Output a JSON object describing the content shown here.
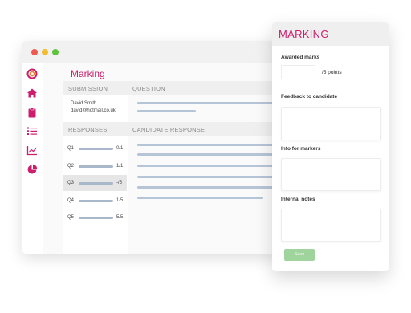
{
  "app": {
    "page_title": "Marking",
    "brand_color": "#cc1e6c"
  },
  "sidebar": {
    "icons": [
      "logo-icon",
      "home-icon",
      "clipboard-icon",
      "list-icon",
      "trend-icon",
      "pie-chart-icon",
      "user-icon"
    ]
  },
  "table": {
    "submission_header": "SUBMISSION",
    "question_header": "QUESTION",
    "responses_header": "RESPONSES",
    "candidate_response_header": "CANDIDATE RESPONSE",
    "candidate": {
      "name": "David Smith",
      "email": "david@hotmail.co.uk"
    },
    "responses": [
      {
        "label": "Q1",
        "score": "0/1",
        "selected": false
      },
      {
        "label": "Q2",
        "score": "1/1",
        "selected": false
      },
      {
        "label": "Q3",
        "score": "-/5",
        "selected": true
      },
      {
        "label": "Q4",
        "score": "1/5",
        "selected": false
      },
      {
        "label": "Q5",
        "score": "5/5",
        "selected": false
      }
    ]
  },
  "panel": {
    "title": "MARKING",
    "awarded_marks_label": "Awarded marks",
    "awarded_marks_value": "",
    "points_suffix": "/5 points",
    "feedback_label": "Feedback to candidate",
    "feedback_value": "",
    "info_label": "Info for markers",
    "info_value": "",
    "notes_label": "Internal notes",
    "notes_value": "",
    "save_label": "Save",
    "save_color": "#9fd49d"
  }
}
